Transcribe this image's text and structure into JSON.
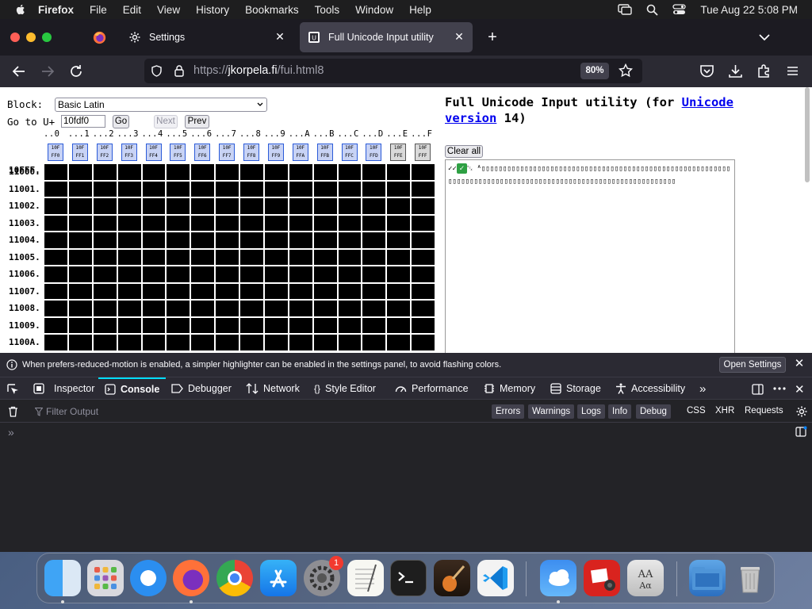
{
  "menubar": {
    "app": "Firefox",
    "items": [
      "File",
      "Edit",
      "View",
      "History",
      "Bookmarks",
      "Tools",
      "Window",
      "Help"
    ],
    "datetime": "Tue Aug 22  5:08 PM"
  },
  "tabs": [
    {
      "title": "Settings",
      "icon": "gear-icon"
    },
    {
      "title": "Full Unicode Input utility",
      "icon": "fui-favicon",
      "active": true
    }
  ],
  "navbar": {
    "url_prefix": "https://",
    "url_host": "jkorpela.fi",
    "url_path": "/fui.html8",
    "zoom": "80%"
  },
  "page": {
    "block_label": "Block:",
    "block_value": "Basic Latin",
    "goto_label": "Go to U+",
    "goto_value": "10fdf0",
    "go_btn": "Go",
    "next_btn": "Next",
    "prev_btn": "Prev",
    "col_headers": [
      "..0",
      "...1",
      "...2",
      "...3",
      "...4",
      "...5",
      "...6",
      "...7",
      "...8",
      "...9",
      "...A",
      "...B",
      "...C",
      "...D",
      "...E",
      "...F"
    ],
    "row_headers": [
      "10FFF.",
      "11000.",
      "11001.",
      "11002.",
      "11003.",
      "11004.",
      "11005.",
      "11006.",
      "11007.",
      "11008.",
      "11009.",
      "1100A."
    ],
    "first_row_glyphs": [
      "10F FF0",
      "10F FF1",
      "10F FF2",
      "10F FF3",
      "10F FF4",
      "10F FF5",
      "10F FF6",
      "10F FF7",
      "10F FF8",
      "10F FF9",
      "10F FFA",
      "10F FFB",
      "10F FFC",
      "10F FFD",
      "10F FFE",
      "10F FFF"
    ],
    "title_part1": "Full Unicode Input utility (for ",
    "title_link": "Unicode version",
    "title_part2": " 14)",
    "clear_all": "Clear all",
    "output_prefix": "✓✓",
    "output_check": "✓",
    "output_text": "␂ ᴬ▯▯▯▯▯▯▯▯▯▯▯▯▯▯▯▯▯▯▯▯▯▯▯▯▯▯▯▯▯▯▯▯▯▯▯▯▯▯▯▯▯▯▯▯▯▯▯▯▯▯▯▯▯▯▯▯▯▯▯▯▯▯▯▯▯▯▯▯▯▯▯▯▯▯▯▯▯▯▯▯▯▯▯▯▯▯▯▯▯▯▯▯▯▯▯▯▯▯▯▯▯▯▯▯▯▯▯▯▯▯▯"
  },
  "devtools": {
    "notice": "When prefers-reduced-motion is enabled, a simpler highlighter can be enabled in the settings panel, to avoid flashing colors.",
    "open_settings": "Open Settings",
    "tabs": [
      "Inspector",
      "Console",
      "Debugger",
      "Network",
      "Style Editor",
      "Performance",
      "Memory",
      "Storage",
      "Accessibility"
    ],
    "filter_placeholder": "Filter Output",
    "levels": [
      "Errors",
      "Warnings",
      "Logs",
      "Info",
      "Debug"
    ],
    "types": [
      "CSS",
      "XHR",
      "Requests"
    ]
  },
  "dock": {
    "apps": [
      "Finder",
      "Launchpad",
      "Safari",
      "Firefox",
      "Chrome",
      "App Store",
      "System Settings",
      "TextEdit",
      "Terminal",
      "GarageBand",
      "Visual Studio Code",
      "Weather",
      "Photo Booth",
      "Dictionary",
      "Screenshot",
      "Trash"
    ],
    "settings_badge": "1"
  }
}
